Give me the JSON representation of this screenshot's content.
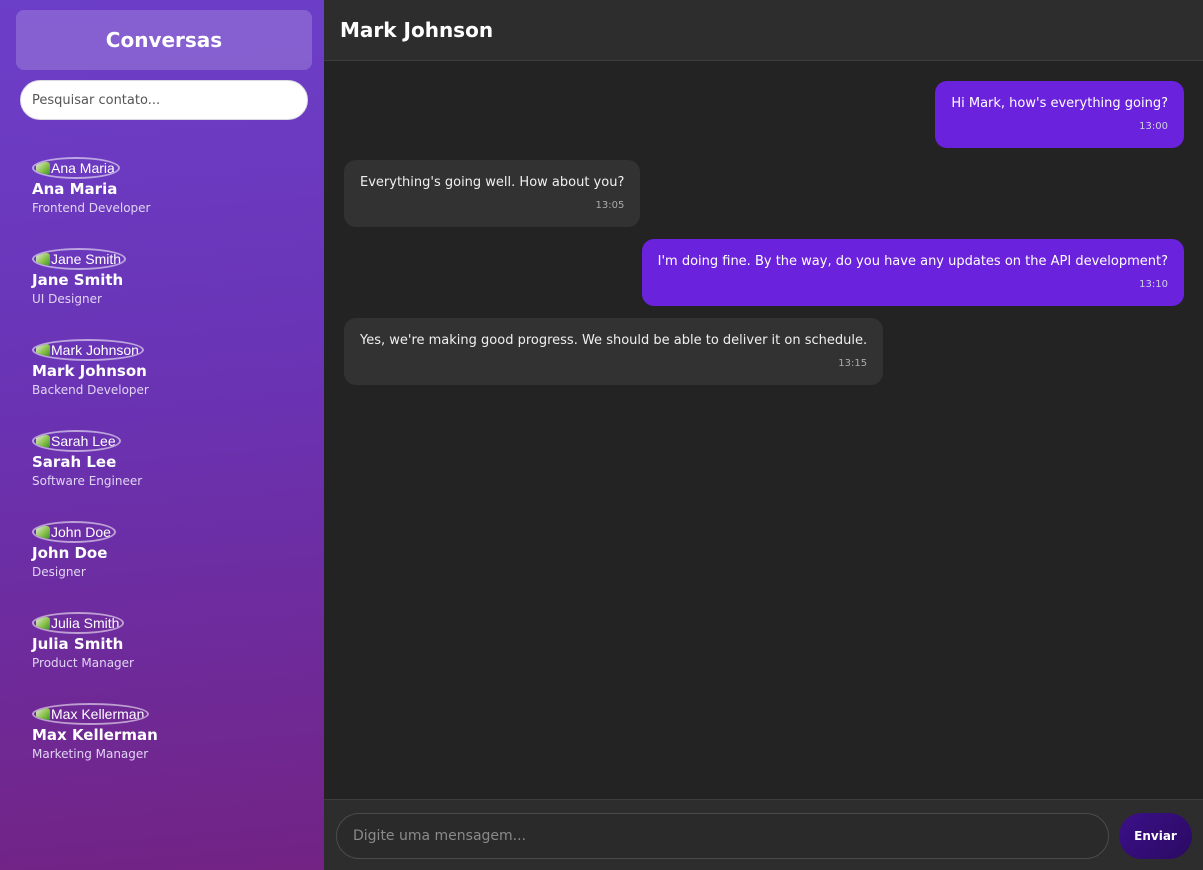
{
  "sidebar": {
    "title": "Conversas",
    "search": {
      "placeholder": "Pesquisar contato...",
      "value": ""
    },
    "contacts": [
      {
        "name": "Ana Maria",
        "role": "Frontend Developer",
        "avatar_alt": "Ana Maria"
      },
      {
        "name": "Jane Smith",
        "role": "UI Designer",
        "avatar_alt": "Jane Smith"
      },
      {
        "name": "Mark Johnson",
        "role": "Backend Developer",
        "avatar_alt": "Mark Johnson"
      },
      {
        "name": "Sarah Lee",
        "role": "Software Engineer",
        "avatar_alt": "Sarah Lee"
      },
      {
        "name": "John Doe",
        "role": "Designer",
        "avatar_alt": "John Doe"
      },
      {
        "name": "Julia Smith",
        "role": "Product Manager",
        "avatar_alt": "Julia Smith"
      },
      {
        "name": "Max Kellerman",
        "role": "Marketing Manager",
        "avatar_alt": "Max Kellerman"
      }
    ]
  },
  "chat": {
    "title": "Mark Johnson",
    "messages": [
      {
        "direction": "sent",
        "text": "Hi Mark, how's everything going?",
        "time": "13:00"
      },
      {
        "direction": "received",
        "text": "Everything's going well. How about you?",
        "time": "13:05"
      },
      {
        "direction": "sent",
        "text": "I'm doing fine. By the way, do you have any updates on the API development?",
        "time": "13:10"
      },
      {
        "direction": "received",
        "text": "Yes, we're making good progress. We should be able to deliver it on schedule.",
        "time": "13:15"
      }
    ]
  },
  "composer": {
    "placeholder": "Digite uma mensagem...",
    "value": "",
    "send_label": "Enviar"
  },
  "colors": {
    "sent_bubble": "#6a22dc",
    "received_bubble": "#323232",
    "sidebar_gradient_top": "#6c3fc9",
    "sidebar_gradient_bottom": "#722384",
    "background": "#232323"
  },
  "icons": {
    "avatar": "broken-image-icon"
  }
}
